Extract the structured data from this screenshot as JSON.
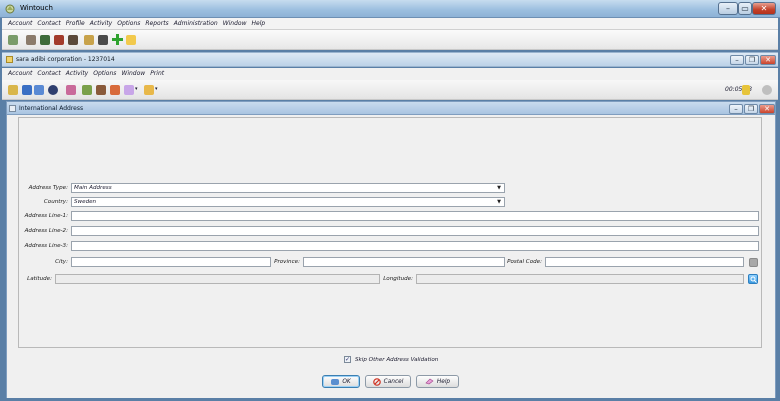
{
  "window": {
    "title": "Wintouch",
    "buttons": [
      "minimize",
      "maximize",
      "close"
    ]
  },
  "main_menu": [
    "Account",
    "Contact",
    "Profile",
    "Activity",
    "Options",
    "Reports",
    "Administration",
    "Window",
    "Help"
  ],
  "inner_window": {
    "title": "sara adibi corporation - 1237014"
  },
  "inner_menu": [
    "Account",
    "Contact",
    "Activity",
    "Options",
    "Window",
    "Print"
  ],
  "timer": "00:05:58",
  "dialog": {
    "title": "International Address",
    "fields": {
      "address_type": {
        "label": "Address Type:",
        "value": "Main Address"
      },
      "country": {
        "label": "Country:",
        "value": "Sweden"
      },
      "address_line_1": {
        "label": "Address Line-1:",
        "value": ""
      },
      "address_line_2": {
        "label": "Address Line-2:",
        "value": ""
      },
      "address_line_3": {
        "label": "Address Line-3:",
        "value": ""
      },
      "city": {
        "label": "City:",
        "value": ""
      },
      "province": {
        "label": "Province:",
        "value": ""
      },
      "postal_code": {
        "label": "Postal Code:",
        "value": ""
      },
      "latitude": {
        "label": "Latitude:",
        "value": ""
      },
      "longitude": {
        "label": "Longitude:",
        "value": ""
      }
    },
    "skip_validation": {
      "label": "Skip Other Address Validation",
      "checked": true
    },
    "buttons": {
      "ok": "OK",
      "cancel": "Cancel",
      "help": "Help"
    }
  },
  "colors": {
    "accent": "#3c7fb1",
    "title_bar": "#a9c4e1",
    "close_red": "#c3412a"
  }
}
